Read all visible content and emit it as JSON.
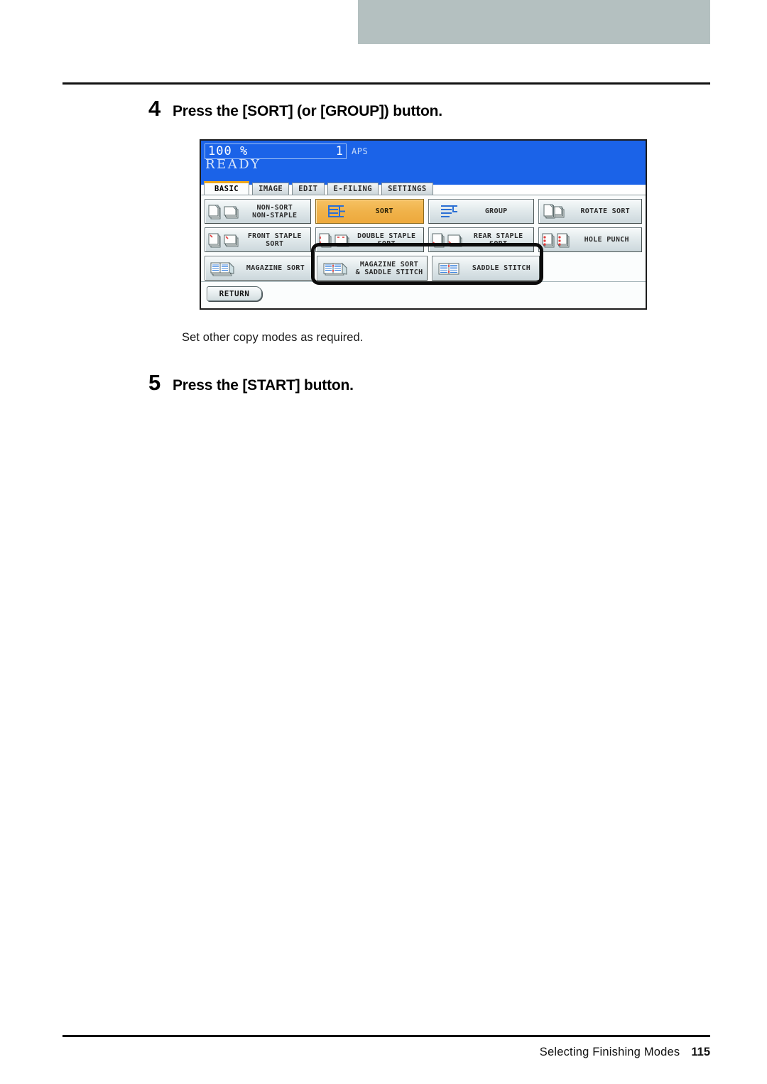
{
  "page": {
    "footer_title": "Selecting Finishing Modes",
    "footer_page": "115"
  },
  "steps": [
    {
      "number": "4",
      "title": "Press the [SORT] (or [GROUP]) button."
    },
    {
      "number": "5",
      "title": "Press the [START] button."
    }
  ],
  "caption": "Set other copy modes as required.",
  "lcd": {
    "status": {
      "zoom_ratio": "100 %",
      "copies": "1",
      "paper_mode": "APS",
      "ready": "READY"
    },
    "tabs": [
      {
        "label": "BASIC",
        "active": true
      },
      {
        "label": "IMAGE",
        "active": false
      },
      {
        "label": "EDIT",
        "active": false
      },
      {
        "label": "E-FILING",
        "active": false
      },
      {
        "label": "SETTINGS",
        "active": false
      }
    ],
    "buttons": {
      "row1": [
        {
          "label": "NON-SORT\nNON-STAPLE",
          "icon": "two-stacks-icon",
          "selected": false
        },
        {
          "label": "SORT",
          "icon": "sort-lines-icon",
          "selected": true
        },
        {
          "label": "GROUP",
          "icon": "group-lines-icon",
          "selected": false
        },
        {
          "label": "ROTATE SORT",
          "icon": "rotated-stacks-icon",
          "selected": false
        }
      ],
      "row2": [
        {
          "label": "FRONT STAPLE\nSORT",
          "icon": "front-staple-icon",
          "selected": false
        },
        {
          "label": "DOUBLE STAPLE\nSORT",
          "icon": "double-staple-icon",
          "selected": false
        },
        {
          "label": "REAR STAPLE\nSORT",
          "icon": "rear-staple-icon",
          "selected": false
        },
        {
          "label": "HOLE PUNCH",
          "icon": "hole-punch-icon",
          "selected": false
        }
      ],
      "row3": [
        {
          "label": "MAGAZINE SORT",
          "icon": "magazine-sort-icon",
          "selected": false
        },
        {
          "label": "MAGAZINE SORT\n& SADDLE STITCH",
          "icon": "magazine-saddle-icon",
          "selected": false
        },
        {
          "label": "SADDLE STITCH",
          "icon": "saddle-stitch-icon",
          "selected": false
        }
      ]
    },
    "return_label": "RETURN"
  },
  "colors": {
    "lcd_header_blue": "#1b63e8",
    "selected_orange": "#f0b24a",
    "tab_accent": "#f0a818",
    "top_bar_grey": "#b4c0c0"
  }
}
